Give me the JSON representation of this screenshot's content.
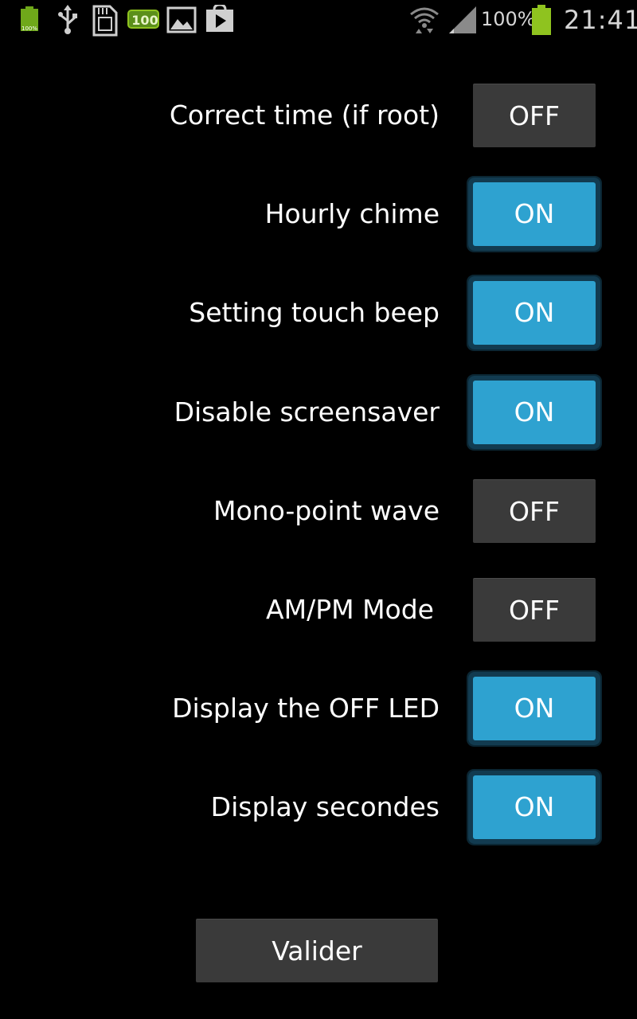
{
  "status_bar": {
    "battery_small_label": "100%",
    "notification_badge": "100",
    "battery_percent": "100%",
    "time": "21:41",
    "icons": [
      "battery-small-icon",
      "usb-icon",
      "sd-card-icon",
      "notification-100-icon",
      "gallery-icon",
      "play-store-icon",
      "wifi-icon",
      "signal-icon",
      "battery-icon"
    ],
    "colors": {
      "battery_green": "#8fc31f",
      "text": "#d6d6d6"
    }
  },
  "settings": [
    {
      "label": "Correct time (if root)",
      "state": "OFF"
    },
    {
      "label": "Hourly chime",
      "state": "ON"
    },
    {
      "label": "Setting touch beep",
      "state": "ON"
    },
    {
      "label": "Disable screensaver",
      "state": "ON"
    },
    {
      "label": "Mono-point wave",
      "state": "OFF"
    },
    {
      "label": "AM/PM Mode",
      "state": "OFF"
    },
    {
      "label": "Display the OFF LED",
      "state": "ON"
    },
    {
      "label": "Display secondes",
      "state": "ON"
    }
  ],
  "valider_label": "Valider",
  "colors": {
    "toggle_on": "#2ea2d0",
    "toggle_off": "#3a3a3a",
    "background": "#000000"
  }
}
